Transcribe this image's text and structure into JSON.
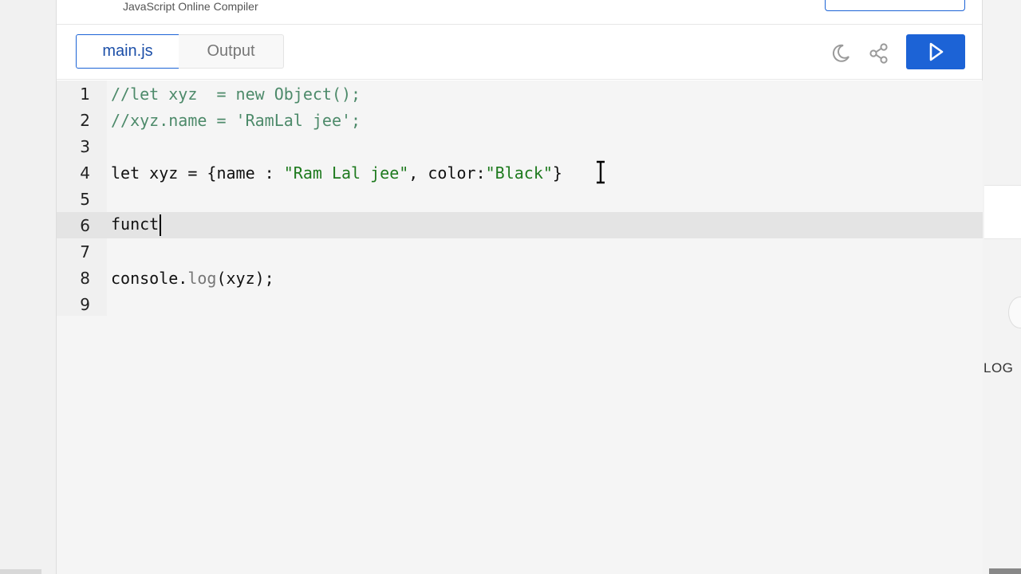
{
  "header": {
    "subtitle": "JavaScript Online Compiler"
  },
  "tabs": [
    {
      "label": "main.js",
      "active": true
    },
    {
      "label": "Output",
      "active": false
    }
  ],
  "toolbar": {
    "theme_icon": "moon-icon",
    "share_icon": "share-icon",
    "run_icon": "play-icon"
  },
  "editor": {
    "active_line": 6,
    "line_numbers": [
      "1",
      "2",
      "3",
      "4",
      "5",
      "6",
      "7",
      "8",
      "9"
    ],
    "lines": [
      {
        "comment": "//let xyz  = new Object();"
      },
      {
        "comment": "//xyz.name = 'RamLal jee';"
      },
      {},
      {
        "kw": "let xyz = {name : ",
        "s1": "\"Ram Lal jee\"",
        "mid": ", color:",
        "s2": "\"Black\"",
        "end": "}"
      },
      {},
      {
        "text": "funct"
      },
      {},
      {
        "obj": "console",
        "dot": ".",
        "method": "log",
        "rest": "(xyz);"
      },
      {}
    ]
  },
  "side": {
    "right_text": "LOG"
  },
  "colors": {
    "accent": "#1c63d6",
    "comment": "#4d8a6a",
    "string": "#1e7a1e",
    "active_line_bg": "#e4e4e4",
    "editor_bg": "#f5f5f5"
  }
}
